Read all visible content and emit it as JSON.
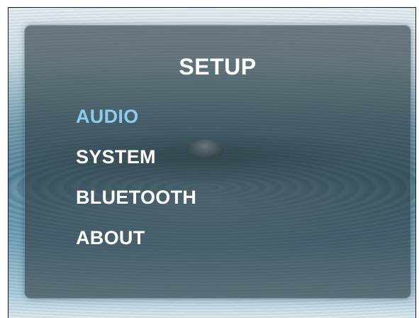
{
  "setup": {
    "title": "SETUP",
    "selected_index": 0,
    "items": [
      {
        "label": "AUDIO"
      },
      {
        "label": "SYSTEM"
      },
      {
        "label": "BLUETOOTH"
      },
      {
        "label": "ABOUT"
      }
    ]
  },
  "colors": {
    "selected_text": "#8ccbf0",
    "text": "#ffffff",
    "panel": "#28373e"
  },
  "icons": {
    "background": "water-drop-image"
  }
}
